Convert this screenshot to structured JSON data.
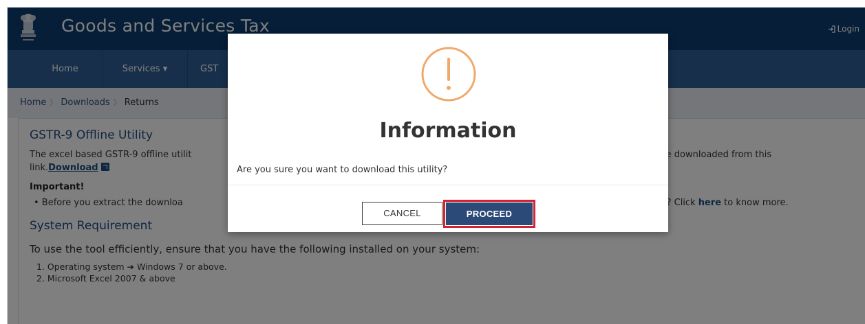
{
  "header": {
    "title": "Goods and Services Tax",
    "login_label": "Login"
  },
  "nav": {
    "items": [
      {
        "label": "Home"
      },
      {
        "label": "Services ▾"
      },
      {
        "label": "GST"
      }
    ]
  },
  "breadcrumb": {
    "items": [
      "Home",
      "Downloads"
    ],
    "current": "Returns"
  },
  "content": {
    "title": "GSTR-9 Offline Utility",
    "desc_left": "The excel based GSTR-9 offline utilit",
    "desc_right": "n be downloaded from this",
    "desc_prefix": "link.",
    "download_label": "Download",
    "important_label": "Important!",
    "bullet_left": "• Before you extract the downloa",
    "bullet_right_prefix": "upt? Click ",
    "bullet_here": "here",
    "bullet_right_suffix": " to know more.",
    "sysreq_title": "System Requirement",
    "ensure_text": "To use the tool efficiently, ensure that you have the following installed on your system:",
    "requirements": [
      "1. Operating system ➔ Windows 7 or above.",
      "2. Microsoft Excel 2007 & above"
    ]
  },
  "modal": {
    "icon": "exclamation-circle-icon",
    "title": "Information",
    "message": "Are you sure you want to download this utility?",
    "cancel_label": "CANCEL",
    "proceed_label": "PROCEED"
  },
  "colors": {
    "header_bg": "#0d3d70",
    "nav_bg": "#2e5f97",
    "warning_orange": "#f0a96a",
    "proceed_bg": "#2c4a78",
    "highlight_red": "#d4232f"
  }
}
